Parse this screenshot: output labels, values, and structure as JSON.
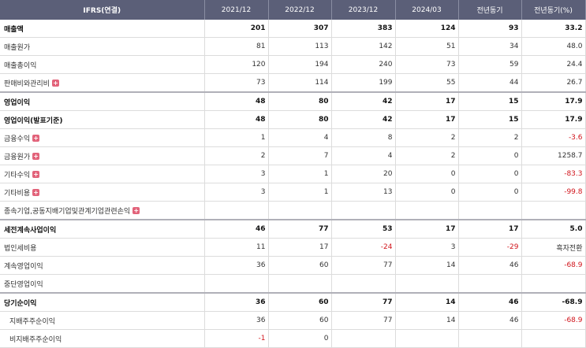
{
  "header": [
    "IFRS(연결)",
    "2021/12",
    "2022/12",
    "2023/12",
    "2024/03",
    "전년동기",
    "전년동기(%)"
  ],
  "rows": [
    {
      "label": "매출액",
      "values": [
        "201",
        "307",
        "383",
        "124",
        "93",
        "33.2"
      ],
      "bold": true,
      "neg": []
    },
    {
      "label": "매출원가",
      "values": [
        "81",
        "113",
        "142",
        "51",
        "34",
        "48.0"
      ],
      "neg": []
    },
    {
      "label": "매출총이익",
      "values": [
        "120",
        "194",
        "240",
        "73",
        "59",
        "24.4"
      ],
      "neg": []
    },
    {
      "label": "판매비와관리비",
      "plus": true,
      "values": [
        "73",
        "114",
        "199",
        "55",
        "44",
        "26.7"
      ],
      "neg": []
    },
    {
      "label": "영업이익",
      "values": [
        "48",
        "80",
        "42",
        "17",
        "15",
        "17.9"
      ],
      "bold": true,
      "thick": true,
      "neg": []
    },
    {
      "label": "영업이익(발표기준)",
      "values": [
        "48",
        "80",
        "42",
        "17",
        "15",
        "17.9"
      ],
      "bold": true,
      "neg": []
    },
    {
      "label": "금융수익",
      "plus": true,
      "values": [
        "1",
        "4",
        "8",
        "2",
        "2",
        "-3.6"
      ],
      "neg": [
        5
      ]
    },
    {
      "label": "금융원가",
      "plus": true,
      "values": [
        "2",
        "7",
        "4",
        "2",
        "0",
        "1258.7"
      ],
      "neg": []
    },
    {
      "label": "기타수익",
      "plus": true,
      "values": [
        "3",
        "1",
        "20",
        "0",
        "0",
        "-83.3"
      ],
      "neg": [
        5
      ]
    },
    {
      "label": "기타비용",
      "plus": true,
      "values": [
        "3",
        "1",
        "13",
        "0",
        "0",
        "-99.8"
      ],
      "neg": [
        5
      ]
    },
    {
      "label": "종속기업,공동지배기업및관계기업관련손익",
      "plus": true,
      "values": [
        "",
        "",
        "",
        "",
        "",
        ""
      ],
      "neg": []
    },
    {
      "label": "세전계속사업이익",
      "values": [
        "46",
        "77",
        "53",
        "17",
        "17",
        "5.0"
      ],
      "bold": true,
      "thick": true,
      "neg": []
    },
    {
      "label": "법인세비용",
      "values": [
        "11",
        "17",
        "-24",
        "3",
        "-29",
        "흑자전환"
      ],
      "neg": [
        2,
        4
      ]
    },
    {
      "label": "계속영업이익",
      "values": [
        "36",
        "60",
        "77",
        "14",
        "46",
        "-68.9"
      ],
      "neg": [
        5
      ]
    },
    {
      "label": "중단영업이익",
      "values": [
        "",
        "",
        "",
        "",
        "",
        ""
      ],
      "neg": []
    },
    {
      "label": "당기순이익",
      "values": [
        "36",
        "60",
        "77",
        "14",
        "46",
        "-68.9"
      ],
      "bold": true,
      "thick": true,
      "neg": [
        5
      ]
    },
    {
      "label": "지배주주순이익",
      "indent": true,
      "values": [
        "36",
        "60",
        "77",
        "14",
        "46",
        "-68.9"
      ],
      "neg": [
        5
      ]
    },
    {
      "label": "비지배주주순이익",
      "indent": true,
      "values": [
        "-1",
        "0",
        "",
        "",
        "",
        ""
      ],
      "neg": [
        0
      ]
    }
  ]
}
